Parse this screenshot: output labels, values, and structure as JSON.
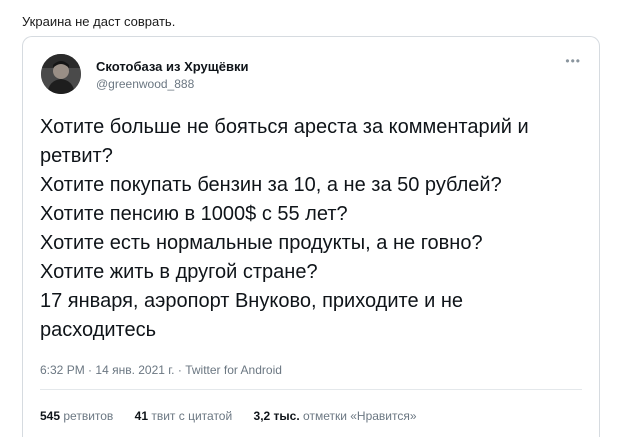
{
  "caption": "Украина не даст соврать.",
  "tweet": {
    "display_name": "Скотобаза из Хрущёвки",
    "handle": "@greenwood_888",
    "more_glyph": "•••",
    "lines": [
      "Хотите больше не бояться ареста за комментарий и",
      "ретвит?",
      "Хотите покупать бензин за 10, а не за 50 рублей?",
      "Хотите пенсию в 1000$ с 55 лет?",
      "Хотите есть нормальные продукты, а не говно?",
      "Хотите жить в другой стране?",
      "17 января, аэропорт Внуково, приходите и не",
      "расходитесь"
    ],
    "time": "6:32 PM",
    "date": "14 янв. 2021 г.",
    "separator": "·",
    "source": "Twitter for Android",
    "stats": {
      "retweets_count": "545",
      "retweets_label": "ретвитов",
      "quotes_count": "41",
      "quotes_label": "твит с цитатой",
      "likes_count": "3,2 тыс.",
      "likes_label": "отметки «Нравится»"
    }
  }
}
